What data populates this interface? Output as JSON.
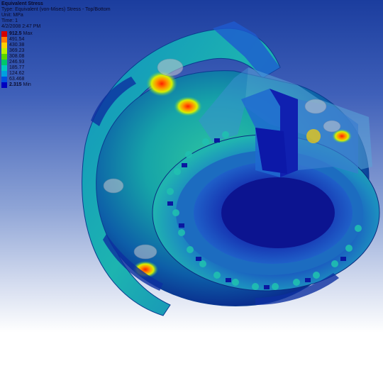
{
  "header": {
    "title": "Equivalent Stress",
    "type_line": "Type: Equivalent (von-Mises) Stress - Top/Bottom",
    "unit_line": "Unit: MPa",
    "time_line": "Time: 1",
    "date_line": "4/2/2008 2:47 PM"
  },
  "legend": {
    "items": [
      {
        "value": "912.5",
        "tag": "Max",
        "color": "#d40000"
      },
      {
        "value": "491.54",
        "tag": "",
        "color": "#ff7a00"
      },
      {
        "value": "430.38",
        "tag": "",
        "color": "#ffd000"
      },
      {
        "value": "369.23",
        "tag": "",
        "color": "#b9f000"
      },
      {
        "value": "308.08",
        "tag": "",
        "color": "#58d600"
      },
      {
        "value": "246.93",
        "tag": "",
        "color": "#00c86a"
      },
      {
        "value": "185.77",
        "tag": "",
        "color": "#00c8c0"
      },
      {
        "value": "124.62",
        "tag": "",
        "color": "#00a0e0"
      },
      {
        "value": "63.468",
        "tag": "",
        "color": "#0050e0"
      },
      {
        "value": "2.315",
        "tag": "Min",
        "color": "#0000c0"
      }
    ]
  },
  "model": {
    "description_label": "FEA stress plot of cut-away circular housing",
    "colors": {
      "low": "#0a1ab0",
      "mid": "#1fb4a8",
      "high": "#e03010"
    }
  }
}
